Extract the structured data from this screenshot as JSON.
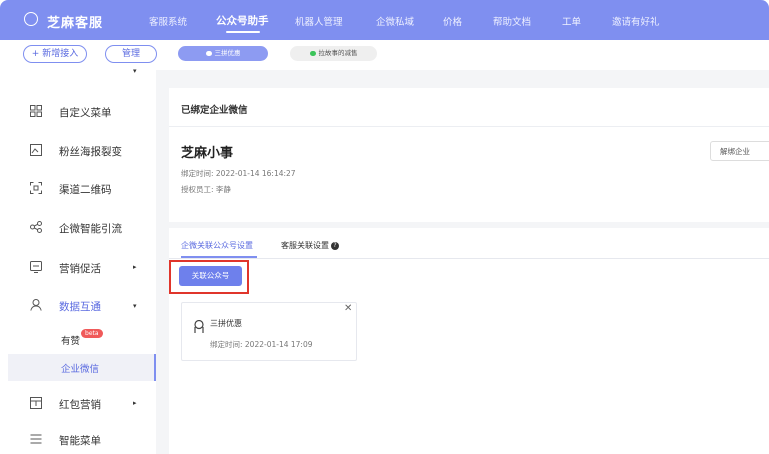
{
  "header": {
    "brand": "芝麻客服",
    "nav": [
      "客服系统",
      "公众号助手",
      "机器人管理",
      "企微私域",
      "价格",
      "帮助文档",
      "工单",
      "邀请有好礼"
    ],
    "active_nav": "公众号助手"
  },
  "toolbar": {
    "add_label": "+ 新增接入",
    "manage_label": "管理",
    "chips": [
      {
        "label": "三拼优惠",
        "dot_color": "#ffffff"
      },
      {
        "label": "拉故事的减售",
        "dot_color": "#3cc45a"
      }
    ]
  },
  "sidebar": {
    "items": [
      {
        "label": "自定义菜单",
        "icon": "grid-icon"
      },
      {
        "label": "粉丝海报裂变",
        "icon": "poster-icon"
      },
      {
        "label": "渠道二维码",
        "icon": "qrcode-icon"
      },
      {
        "label": "企微智能引流",
        "icon": "share-icon"
      },
      {
        "label": "营销促活",
        "icon": "chat-icon"
      },
      {
        "label": "数据互通",
        "icon": "user-icon"
      },
      {
        "label": "红包营销",
        "icon": "gift-icon"
      },
      {
        "label": "智能菜单",
        "icon": "menu-icon"
      }
    ],
    "sub_items": [
      {
        "label": "有赞",
        "badge": "beta"
      },
      {
        "label": "企业微信"
      }
    ]
  },
  "bound": {
    "title": "已绑定企业微信",
    "company": "芝麻小事",
    "bind_time": "绑定时间:  2022-01-14 16:14:27",
    "staff": "授权员工:  李静",
    "unbind_label": "解绑企业"
  },
  "settings": {
    "tabs": [
      "企微关联公众号设置",
      "客服关联设置"
    ],
    "link_button": "关联公众号",
    "account": {
      "name": "三拼优惠",
      "bind_time": "绑定时间:  2022-01-14 17:09"
    }
  },
  "colors": {
    "accent": "#7f8ff0",
    "highlight": "#e0352b",
    "beta_badge": "#f05a5a"
  }
}
